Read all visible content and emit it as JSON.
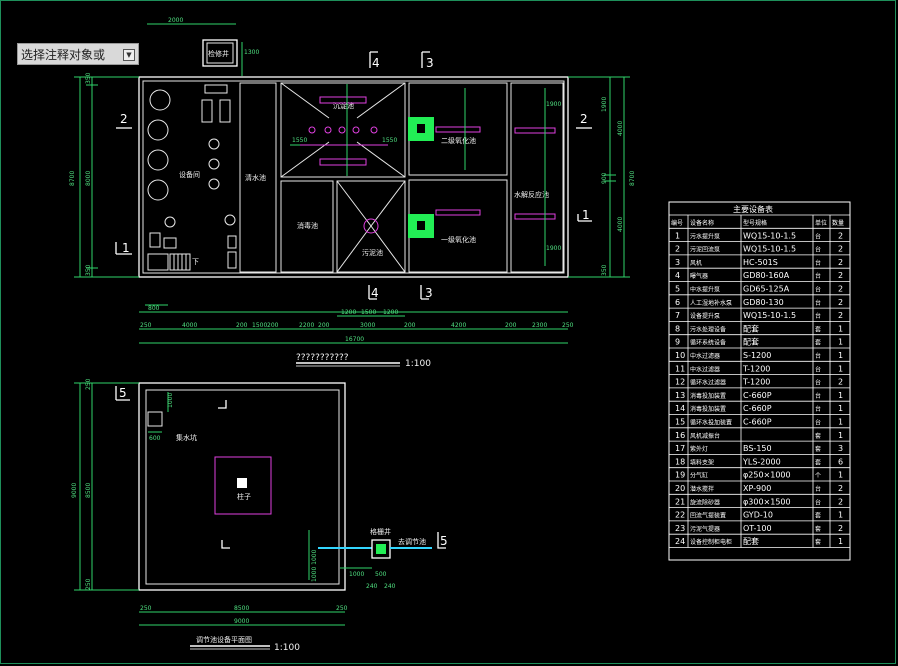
{
  "command_prompt": {
    "text": "选择注释对象或",
    "arrow": "▼"
  },
  "plan1": {
    "rooms": {
      "equipment": "设备间",
      "clear_water": "清水池",
      "sedimentation": "沉淀池",
      "disinfection": "消毒池",
      "sludge": "污泥池",
      "aeration_top": "二级氧化池",
      "aeration_bottom": "一级氧化池",
      "anaerobic": "水解反应池",
      "grit_well": "检修井",
      "stair_label": "下"
    },
    "section_labels": [
      "4",
      "3",
      "2",
      "2",
      "1",
      "1",
      "4",
      "3"
    ],
    "top_dims": [
      "2000",
      "1300"
    ],
    "left_dims": [
      "8700",
      "8000",
      "350",
      "350"
    ],
    "right_dims": [
      "1900",
      "4000",
      "900",
      "4000",
      "350",
      "8700"
    ],
    "inner_dims": [
      "1550",
      "1550",
      "1900",
      "1900"
    ],
    "bottom_dims_row1": [
      "800",
      "1200",
      "1500",
      "1200"
    ],
    "bottom_dims_row2": [
      "250",
      "4000",
      "200",
      "1500",
      "200",
      "2200",
      "200",
      "3000",
      "200",
      "4200",
      "200",
      "2300",
      "250"
    ],
    "total_width": "16700",
    "title": "???????????",
    "scale": "1:100"
  },
  "plan2": {
    "section_left": "5",
    "section_right": "5",
    "room_label": "集水坑",
    "column_label": "柱子",
    "well_label": "格栅井",
    "pipe_label": "去调节池",
    "left_dims": [
      "250",
      "9000",
      "8500",
      "250"
    ],
    "small_dims": [
      "1000",
      "600"
    ],
    "vertical_note": "1000 1000",
    "bottom_small": [
      "1000",
      "500",
      "240",
      "240"
    ],
    "bottom_dims": [
      "250",
      "8500",
      "250"
    ],
    "total_width": "9000",
    "title": "调节池设备平面图",
    "scale": "1:100"
  },
  "equipment_table": {
    "title": "主要设备表",
    "headers": [
      "编号",
      "设备名称",
      "型号规格",
      "单位",
      "数量"
    ],
    "rows": [
      [
        "1",
        "污水提升泵",
        "WQ15-10-1.5",
        "台",
        "2"
      ],
      [
        "2",
        "污泥回流泵",
        "WQ15-10-1.5",
        "台",
        "2"
      ],
      [
        "3",
        "风机",
        "HC-501S",
        "台",
        "2"
      ],
      [
        "4",
        "曝气器",
        "GD80-160A",
        "台",
        "2"
      ],
      [
        "5",
        "中水提升泵",
        "GD65-125A",
        "台",
        "2"
      ],
      [
        "6",
        "人工湿地补水泵",
        "GD80-130",
        "台",
        "2"
      ],
      [
        "7",
        "设备提升泵",
        "WQ15-10-1.5",
        "台",
        "2"
      ],
      [
        "8",
        "污水处理设备",
        "配套",
        "套",
        "1"
      ],
      [
        "9",
        "循环系统设备",
        "配套",
        "套",
        "1"
      ],
      [
        "10",
        "中水过滤器",
        "S-1200",
        "台",
        "1"
      ],
      [
        "11",
        "中水过滤器",
        "T-1200",
        "台",
        "1"
      ],
      [
        "12",
        "循环水过滤器",
        "T-1200",
        "台",
        "2"
      ],
      [
        "13",
        "消毒投加装置",
        "C-660P",
        "台",
        "1"
      ],
      [
        "14",
        "消毒投加装置",
        "C-660P",
        "台",
        "1"
      ],
      [
        "15",
        "循环水投加装置",
        "C-660P",
        "台",
        "1"
      ],
      [
        "16",
        "风机减振台",
        "",
        "套",
        "1"
      ],
      [
        "17",
        "紫外灯",
        "BS-150",
        "套",
        "3"
      ],
      [
        "18",
        "填料支架",
        "YLS-2000",
        "套",
        "6"
      ],
      [
        "19",
        "分气缸",
        "φ250×1000",
        "个",
        "1"
      ],
      [
        "20",
        "潜水搅拌",
        "XP-900",
        "台",
        "2"
      ],
      [
        "21",
        "旋流除砂器",
        "φ300×1500",
        "台",
        "2"
      ],
      [
        "22",
        "回流气提装置",
        "GYD-10",
        "套",
        "1"
      ],
      [
        "23",
        "污泥气提器",
        "OT-100",
        "套",
        "2"
      ],
      [
        "24",
        "设备控制柜电柜",
        "配套",
        "套",
        "1"
      ]
    ]
  }
}
